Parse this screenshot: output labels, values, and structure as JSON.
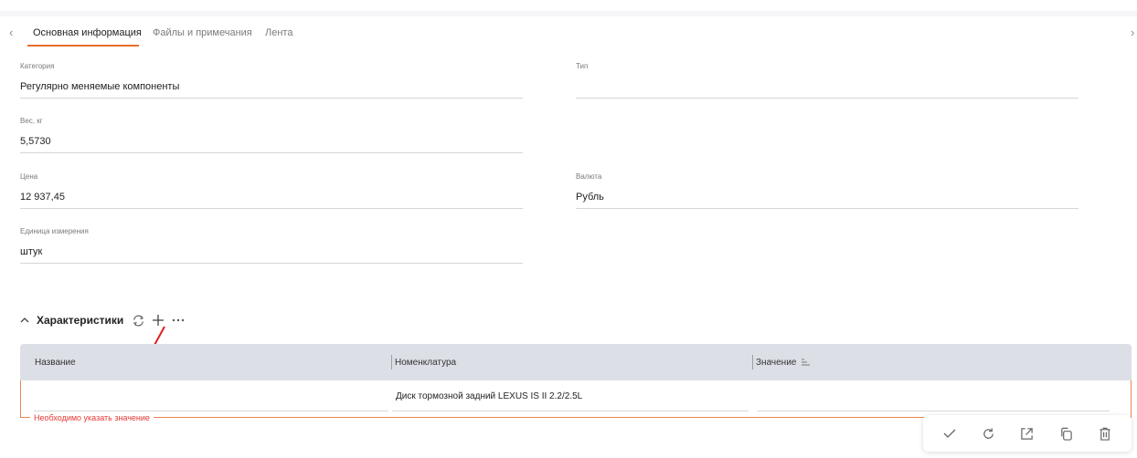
{
  "tabs": {
    "items": [
      {
        "label": "Основная информация",
        "active": true
      },
      {
        "label": "Файлы и примечания",
        "active": false
      },
      {
        "label": "Лента",
        "active": false
      }
    ],
    "accent": "#e8702a"
  },
  "fields": {
    "category": {
      "label": "Категория",
      "value": "Регулярно меняемые компоненты"
    },
    "type": {
      "label": "Тип",
      "value": ""
    },
    "weight": {
      "label": "Вес, кг",
      "value": "5,5730"
    },
    "price": {
      "label": "Цена",
      "value": "12 937,45"
    },
    "currency": {
      "label": "Валюта",
      "value": "Рубль"
    },
    "unit": {
      "label": "Единица измерения",
      "value": "штук"
    }
  },
  "characteristics": {
    "title": "Характеристики",
    "columns": [
      {
        "label": "Название"
      },
      {
        "label": "Номенклатура"
      },
      {
        "label": "Значение"
      }
    ],
    "row": {
      "name": "",
      "nomenclature": "Диск тормозной задний LEXUS IS II 2.2/2.5L",
      "value": ""
    },
    "error": "Необходимо указать значение",
    "error_color": "#e53935"
  },
  "toolbar": {
    "icons": [
      "check-icon",
      "refresh-icon",
      "open-external-icon",
      "copy-icon",
      "delete-icon"
    ]
  }
}
